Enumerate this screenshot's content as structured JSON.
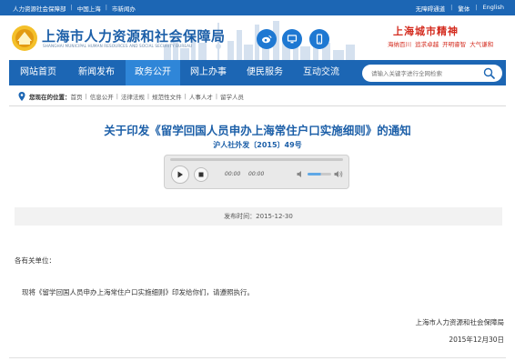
{
  "topbar": {
    "left_links": [
      "人力资源社会保障部",
      "中国上海",
      "市新闻办"
    ],
    "right_links": [
      "无障碍通道",
      "繁体",
      "English"
    ]
  },
  "header": {
    "site_name": "上海市人力资源和社会保障局",
    "site_name_en": "SHANGHAI MUNICIPAL HUMAN RESOURCES AND SOCIAL SECURITY BUREAU",
    "social_icons": [
      "weibo-icon",
      "computer-icon",
      "mobile-icon"
    ],
    "spirit_title": "上海城市精神",
    "spirit_words": "海纳百川  追求卓越  开明睿智  大气谦和"
  },
  "nav": {
    "items": [
      "网站首页",
      "新闻发布",
      "政务公开",
      "网上办事",
      "便民服务",
      "互动交流"
    ],
    "active_index": 2
  },
  "search": {
    "placeholder": "请输入关键字进行全网检索"
  },
  "breadcrumb": {
    "label": "您现在的位置：",
    "items": [
      "首页",
      "信息公开",
      "法律法规",
      "规范性文件",
      "人事人才",
      "留学人员"
    ]
  },
  "document": {
    "title": "关于印发《留学回国人员申办上海常住户口实施细则》的通知",
    "number": "沪人社外发〔2015〕49号",
    "publish_time": "发布时间：2015-12-30",
    "salutation": "各有关单位：",
    "body": "现将《留学回国人员申办上海常住户口实施细则》印发给你们，请遵照执行。",
    "sign_org": "上海市人力资源和社会保障局",
    "sign_date": "2015年12月30日"
  },
  "player": {
    "current_time": "00:00",
    "duration": "00:00",
    "volume": 0.55
  },
  "colors": {
    "brand_blue": "#1c66b4",
    "nav_active": "#2f86d8",
    "title_blue": "#1c5fa8",
    "spirit_red": "#d42b1e"
  }
}
